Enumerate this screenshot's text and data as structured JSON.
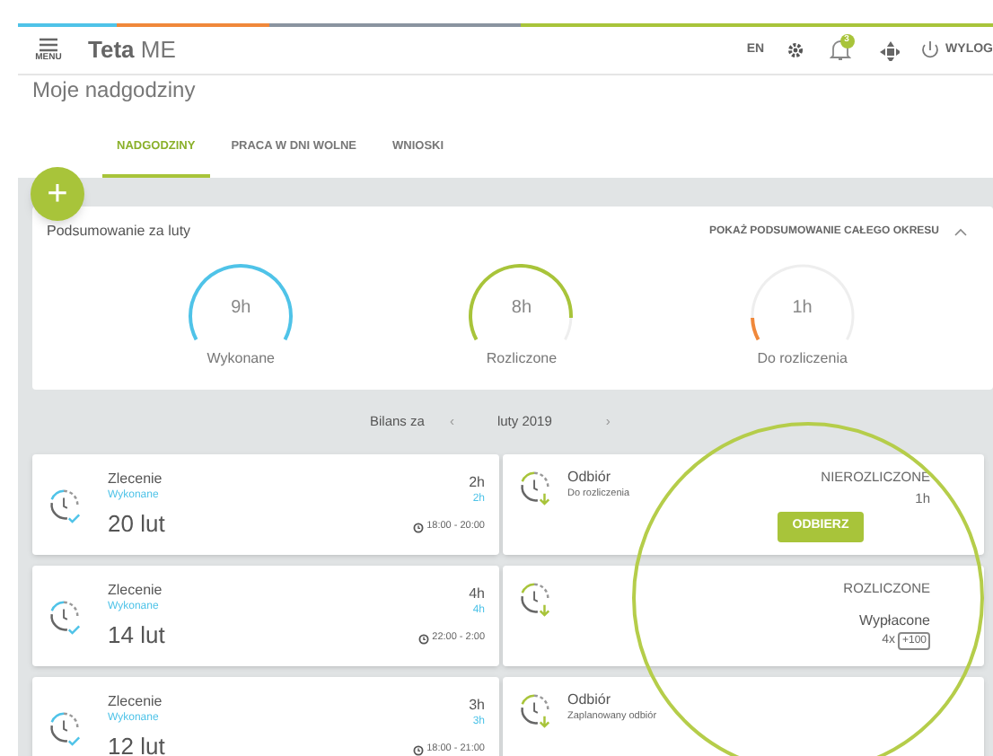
{
  "top_bar": {
    "menu_label": "MENU",
    "app_name_bold": "Teta",
    "app_name_rest": "ME",
    "language": "EN",
    "notification_count": "3",
    "logout": "WYLOG"
  },
  "page_title": "Moje nadgodziny",
  "add_button": "+",
  "tabs": [
    {
      "label": "NADGODZINY",
      "selected": true
    },
    {
      "label": "PRACA W DNI WOLNE",
      "selected": false
    },
    {
      "label": "WNIOSKI",
      "selected": false
    }
  ],
  "summary": {
    "title": "Podsumowanie za luty",
    "link": "POKAŻ PODSUMOWANIE CAŁEGO OKRESU",
    "gauges": [
      {
        "value": "9h",
        "label": "Wykonane",
        "level": 1,
        "color": "#4fc3e8"
      },
      {
        "value": "8h",
        "label": "Rozliczone",
        "level": 0.89,
        "color": "#a8c43a"
      },
      {
        "value": "1h",
        "label": "Do rozliczenia",
        "level": 0.11,
        "color": "#f0883a"
      }
    ]
  },
  "balance": {
    "label": "Bilans za",
    "prev": "‹",
    "period": "luty 2019",
    "next": "›"
  },
  "rows": [
    {
      "left": {
        "title": "Zlecenie",
        "status": "Wykonane",
        "date": "20 lut",
        "hours": "2h",
        "hours_status": "2h",
        "time": "18:00 - 20:00"
      },
      "right": {
        "title": "Odbiór",
        "subtitle": "Do rozliczenia",
        "status": "NIEROZLICZONE",
        "hours": "1h",
        "button": "ODBIERZ"
      }
    },
    {
      "left": {
        "title": "Zlecenie",
        "status": "Wykonane",
        "date": "14 lut",
        "hours": "4h",
        "hours_status": "4h",
        "time": "22:00 - 2:00"
      },
      "right": {
        "status": "ROZLICZONE",
        "payout": "Wypłacone",
        "multiplier": "4x",
        "tag": "+100"
      }
    },
    {
      "left": {
        "title": "Zlecenie",
        "status": "Wykonane",
        "date": "12 lut",
        "hours": "3h",
        "hours_status": "3h",
        "time": "18:00 - 21:00"
      },
      "right": {
        "title": "Odbiór",
        "subtitle": "Zaplanowany odbiór"
      }
    }
  ]
}
